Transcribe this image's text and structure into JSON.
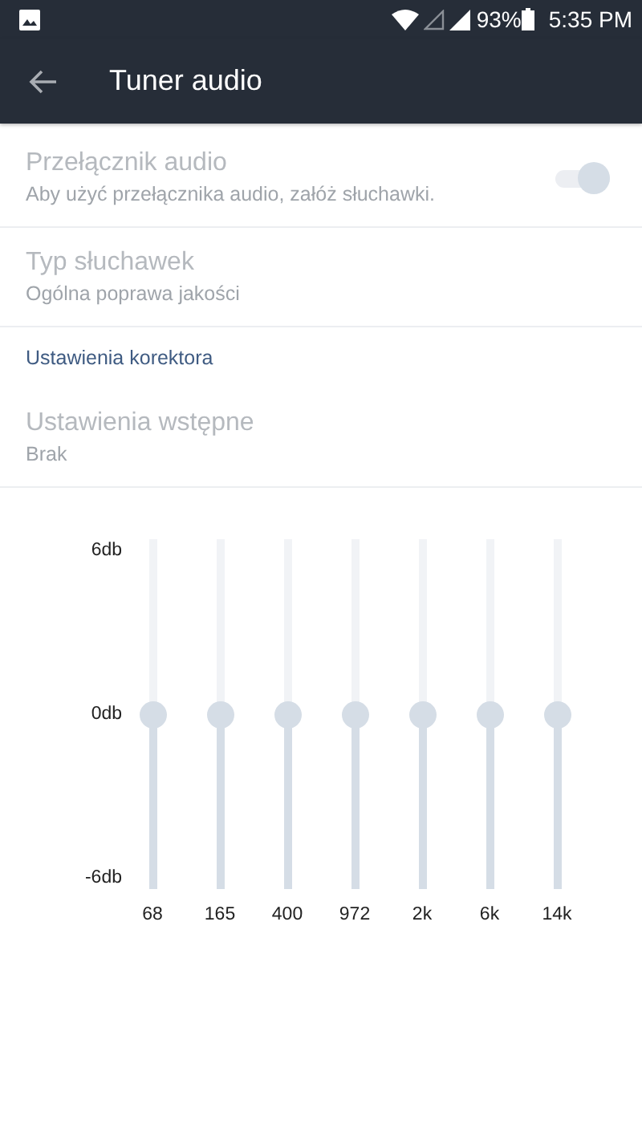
{
  "status_bar": {
    "battery": "93%",
    "time": "5:35 PM"
  },
  "app_bar": {
    "title": "Tuner audio"
  },
  "settings": [
    {
      "kind": "switch",
      "title": "Przełącznik audio",
      "summary": "Aby użyć przełącznika audio, załóż słuchawki.",
      "disabled": true,
      "on": true
    },
    {
      "kind": "item",
      "title": "Typ słuchawek",
      "summary": "Ogólna poprawa jakości",
      "disabled": true
    },
    {
      "kind": "header",
      "title": "Ustawienia korektora"
    },
    {
      "kind": "item",
      "title": "Ustawienia wstępne",
      "summary": "Brak",
      "disabled": true
    }
  ],
  "equalizer": {
    "scale_labels": [
      "6db",
      "0db",
      "-6db"
    ],
    "bands": [
      {
        "label": "68",
        "level": 0.5
      },
      {
        "label": "165",
        "level": 0.5
      },
      {
        "label": "400",
        "level": 0.5
      },
      {
        "label": "972",
        "level": 0.5
      },
      {
        "label": "2k",
        "level": 0.5
      },
      {
        "label": "6k",
        "level": 0.5
      },
      {
        "label": "14k",
        "level": 0.5
      }
    ]
  }
}
